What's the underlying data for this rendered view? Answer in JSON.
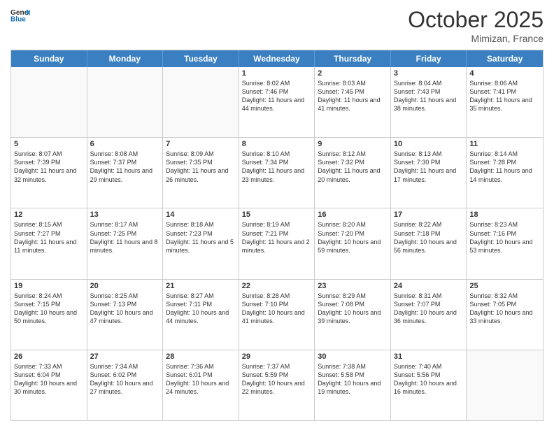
{
  "header": {
    "logo_general": "General",
    "logo_blue": "Blue",
    "month": "October 2025",
    "location": "Mimizan, France"
  },
  "weekdays": [
    "Sunday",
    "Monday",
    "Tuesday",
    "Wednesday",
    "Thursday",
    "Friday",
    "Saturday"
  ],
  "rows": [
    [
      {
        "day": "",
        "empty": true
      },
      {
        "day": "",
        "empty": true
      },
      {
        "day": "",
        "empty": true
      },
      {
        "day": "1",
        "sunrise": "8:02 AM",
        "sunset": "7:46 PM",
        "daylight": "11 hours and 44 minutes."
      },
      {
        "day": "2",
        "sunrise": "8:03 AM",
        "sunset": "7:45 PM",
        "daylight": "11 hours and 41 minutes."
      },
      {
        "day": "3",
        "sunrise": "8:04 AM",
        "sunset": "7:43 PM",
        "daylight": "11 hours and 38 minutes."
      },
      {
        "day": "4",
        "sunrise": "8:06 AM",
        "sunset": "7:41 PM",
        "daylight": "11 hours and 35 minutes."
      }
    ],
    [
      {
        "day": "5",
        "sunrise": "8:07 AM",
        "sunset": "7:39 PM",
        "daylight": "11 hours and 32 minutes."
      },
      {
        "day": "6",
        "sunrise": "8:08 AM",
        "sunset": "7:37 PM",
        "daylight": "11 hours and 29 minutes."
      },
      {
        "day": "7",
        "sunrise": "8:09 AM",
        "sunset": "7:35 PM",
        "daylight": "11 hours and 26 minutes."
      },
      {
        "day": "8",
        "sunrise": "8:10 AM",
        "sunset": "7:34 PM",
        "daylight": "11 hours and 23 minutes."
      },
      {
        "day": "9",
        "sunrise": "8:12 AM",
        "sunset": "7:32 PM",
        "daylight": "11 hours and 20 minutes."
      },
      {
        "day": "10",
        "sunrise": "8:13 AM",
        "sunset": "7:30 PM",
        "daylight": "11 hours and 17 minutes."
      },
      {
        "day": "11",
        "sunrise": "8:14 AM",
        "sunset": "7:28 PM",
        "daylight": "11 hours and 14 minutes."
      }
    ],
    [
      {
        "day": "12",
        "sunrise": "8:15 AM",
        "sunset": "7:27 PM",
        "daylight": "11 hours and 11 minutes."
      },
      {
        "day": "13",
        "sunrise": "8:17 AM",
        "sunset": "7:25 PM",
        "daylight": "11 hours and 8 minutes."
      },
      {
        "day": "14",
        "sunrise": "8:18 AM",
        "sunset": "7:23 PM",
        "daylight": "11 hours and 5 minutes."
      },
      {
        "day": "15",
        "sunrise": "8:19 AM",
        "sunset": "7:21 PM",
        "daylight": "11 hours and 2 minutes."
      },
      {
        "day": "16",
        "sunrise": "8:20 AM",
        "sunset": "7:20 PM",
        "daylight": "10 hours and 59 minutes."
      },
      {
        "day": "17",
        "sunrise": "8:22 AM",
        "sunset": "7:18 PM",
        "daylight": "10 hours and 56 minutes."
      },
      {
        "day": "18",
        "sunrise": "8:23 AM",
        "sunset": "7:16 PM",
        "daylight": "10 hours and 53 minutes."
      }
    ],
    [
      {
        "day": "19",
        "sunrise": "8:24 AM",
        "sunset": "7:15 PM",
        "daylight": "10 hours and 50 minutes."
      },
      {
        "day": "20",
        "sunrise": "8:25 AM",
        "sunset": "7:13 PM",
        "daylight": "10 hours and 47 minutes."
      },
      {
        "day": "21",
        "sunrise": "8:27 AM",
        "sunset": "7:11 PM",
        "daylight": "10 hours and 44 minutes."
      },
      {
        "day": "22",
        "sunrise": "8:28 AM",
        "sunset": "7:10 PM",
        "daylight": "10 hours and 41 minutes."
      },
      {
        "day": "23",
        "sunrise": "8:29 AM",
        "sunset": "7:08 PM",
        "daylight": "10 hours and 39 minutes."
      },
      {
        "day": "24",
        "sunrise": "8:31 AM",
        "sunset": "7:07 PM",
        "daylight": "10 hours and 36 minutes."
      },
      {
        "day": "25",
        "sunrise": "8:32 AM",
        "sunset": "7:05 PM",
        "daylight": "10 hours and 33 minutes."
      }
    ],
    [
      {
        "day": "26",
        "sunrise": "7:33 AM",
        "sunset": "6:04 PM",
        "daylight": "10 hours and 30 minutes."
      },
      {
        "day": "27",
        "sunrise": "7:34 AM",
        "sunset": "6:02 PM",
        "daylight": "10 hours and 27 minutes."
      },
      {
        "day": "28",
        "sunrise": "7:36 AM",
        "sunset": "6:01 PM",
        "daylight": "10 hours and 24 minutes."
      },
      {
        "day": "29",
        "sunrise": "7:37 AM",
        "sunset": "5:59 PM",
        "daylight": "10 hours and 22 minutes."
      },
      {
        "day": "30",
        "sunrise": "7:38 AM",
        "sunset": "5:58 PM",
        "daylight": "10 hours and 19 minutes."
      },
      {
        "day": "31",
        "sunrise": "7:40 AM",
        "sunset": "5:56 PM",
        "daylight": "10 hours and 16 minutes."
      },
      {
        "day": "",
        "empty": true
      }
    ]
  ]
}
